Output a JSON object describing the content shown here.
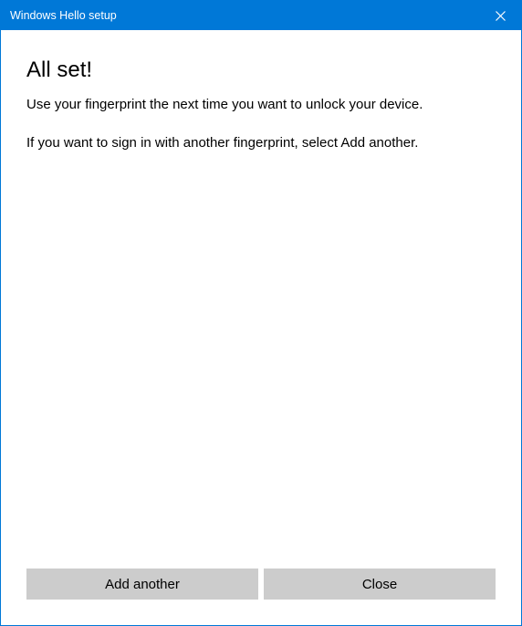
{
  "titlebar": {
    "title": "Windows Hello setup"
  },
  "content": {
    "heading": "All set!",
    "paragraph1": "Use your fingerprint the next time you want to unlock your device.",
    "paragraph2": "If you want to sign in with another fingerprint, select Add another."
  },
  "buttons": {
    "add_another": "Add another",
    "close": "Close"
  }
}
